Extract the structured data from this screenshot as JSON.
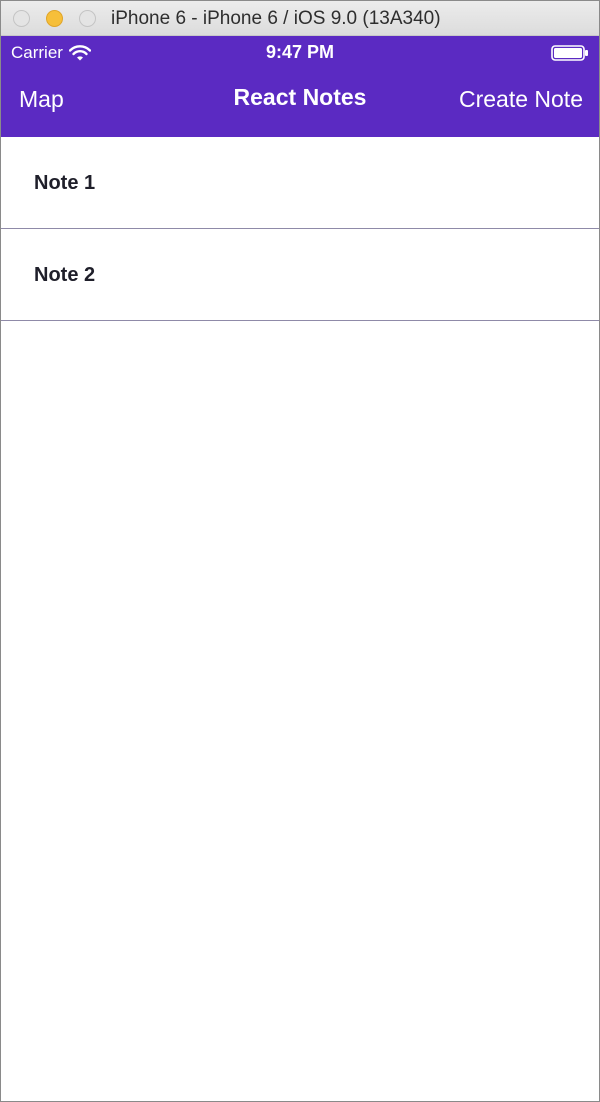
{
  "window": {
    "title": "iPhone 6 - iPhone 6 / iOS 9.0 (13A340)"
  },
  "status_bar": {
    "carrier": "Carrier",
    "time": "9:47 PM",
    "icons": [
      "wifi-icon",
      "battery-icon"
    ]
  },
  "nav": {
    "left_label": "Map",
    "title": "React Notes",
    "right_label": "Create Note"
  },
  "notes": [
    {
      "title": "Note 1"
    },
    {
      "title": "Note 2"
    }
  ],
  "colors": {
    "nav_background": "#5b2ac2",
    "nav_text": "#ffffff",
    "divider": "#8f8aa8",
    "minimize_button": "#f6bf3a"
  }
}
